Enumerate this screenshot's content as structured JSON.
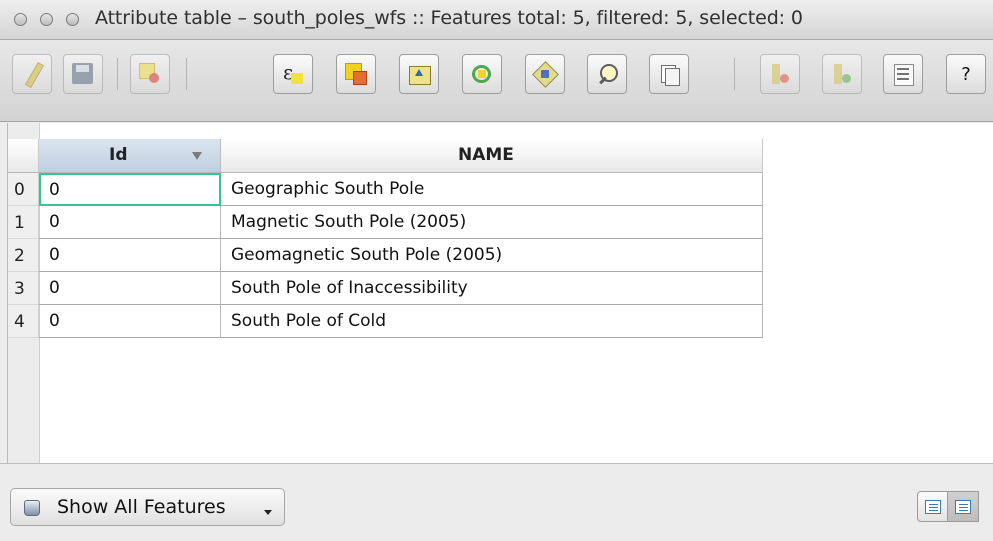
{
  "window": {
    "title": "Attribute table – south_poles_wfs :: Features total: 5, filtered: 5, selected: 0"
  },
  "toolbar": {
    "help_label": "?"
  },
  "table": {
    "columns": [
      "Id",
      "NAME"
    ],
    "rows": [
      {
        "row_header": "0",
        "id": "0",
        "name": "Geographic South Pole"
      },
      {
        "row_header": "1",
        "id": "0",
        "name": "Magnetic South Pole (2005)"
      },
      {
        "row_header": "2",
        "id": "0",
        "name": "Geomagnetic South Pole (2005)"
      },
      {
        "row_header": "3",
        "id": "0",
        "name": "South Pole of Inaccessibility"
      },
      {
        "row_header": "4",
        "id": "0",
        "name": "South Pole of Cold"
      }
    ]
  },
  "bottom": {
    "filter_label": "Show All Features"
  },
  "colors": {
    "current_cell_border": "#35c58e",
    "sorted_header": "#c7d6e6"
  }
}
